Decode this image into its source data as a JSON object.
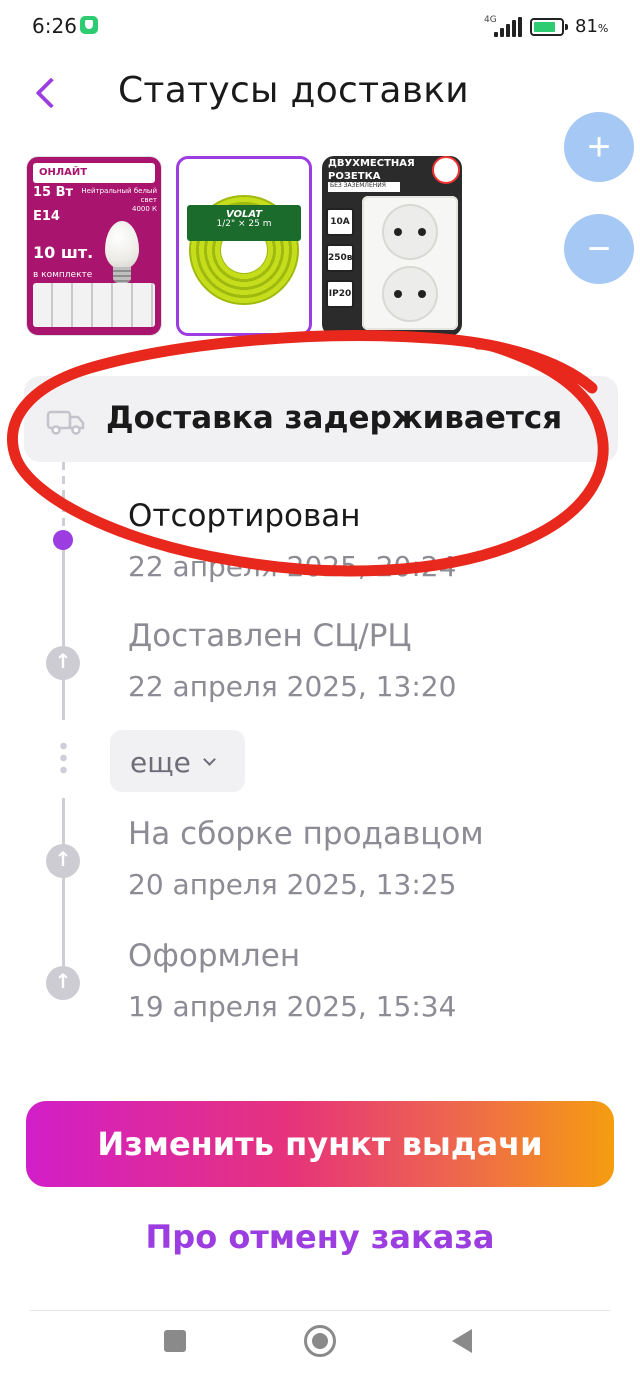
{
  "status_bar": {
    "time": "6:26",
    "network": "4G",
    "battery_percent": "81",
    "battery_unit": "%",
    "battery_level": 0.81
  },
  "header": {
    "title": "Статусы доставки"
  },
  "zoom": {
    "in_symbol": "+",
    "out_symbol": "−"
  },
  "products": [
    {
      "brand": "ОНЛАЙТ",
      "power": "15 Вт",
      "base": "E14",
      "light": "Нейтральный белый свет",
      "temperature": "4000 К",
      "count": "10 шт.",
      "count_note": "в комплекте"
    },
    {
      "brand": "VOLAT",
      "size": "1/2\" × 25 m"
    },
    {
      "header": "ДВУХМЕСТНАЯ РОЗЕТКА",
      "subheader": "БЕЗ ЗАЗЕМЛЕНИЯ",
      "specs": [
        "10A",
        "250в",
        "IP20"
      ]
    }
  ],
  "banner": {
    "text": "Доставка задерживается"
  },
  "timeline": [
    {
      "title": "Отсортирован",
      "date": "22 апреля 2025, 20:24",
      "active": true
    },
    {
      "title": "Доставлен СЦ/РЦ",
      "date": "22 апреля 2025, 13:20",
      "active": false
    },
    {
      "title": "На сборке продавцом",
      "date": "20 апреля 2025, 13:25",
      "active": false
    },
    {
      "title": "Оформлен",
      "date": "19 апреля 2025, 15:34",
      "active": false
    }
  ],
  "more_label": "еще",
  "actions": {
    "primary": "Изменить пункт выдачи",
    "link": "Про отмену заказа"
  },
  "colors": {
    "accent": "#9b3de0",
    "marker": "#e8281c",
    "gradient": [
      "#d21ec8",
      "#e6337b",
      "#f59d0f"
    ]
  }
}
